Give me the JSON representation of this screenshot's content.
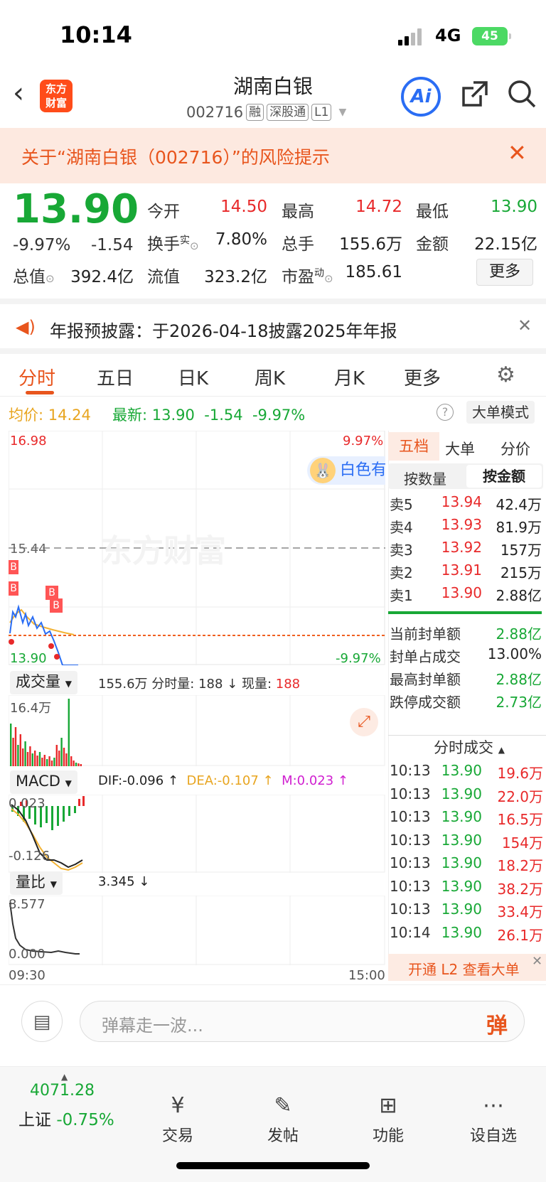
{
  "status_bar": {
    "time": "10:14",
    "network": "4G",
    "battery": "45"
  },
  "header": {
    "logo": "东方财富",
    "title": "湖南白银",
    "code": "002716",
    "tags": [
      "融",
      "深股通",
      "L1"
    ]
  },
  "risk": {
    "text": "关于“湖南白银（002716）”的风险提示"
  },
  "quote": {
    "price": "13.90",
    "change_pct": "-9.97%",
    "change": "-1.54",
    "fields": [
      {
        "label": "今开",
        "value": "14.50"
      },
      {
        "label": "最高",
        "value": "14.72"
      },
      {
        "label": "最低",
        "value": "13.90"
      },
      {
        "label": "换手",
        "value": "7.80%"
      },
      {
        "label": "总手",
        "value": "155.6万"
      },
      {
        "label": "金额",
        "value": "22.15亿"
      },
      {
        "label": "总值",
        "value": "392.4亿"
      },
      {
        "label": "流值",
        "value": "323.2亿"
      },
      {
        "label": "市盈",
        "value": "185.61"
      }
    ],
    "turnover_sup": "实",
    "pe_sup": "动",
    "more": "更多"
  },
  "announcement": {
    "text": "年报预披露：于2026-04-18披露2025年年报"
  },
  "tabs": [
    "分时",
    "五日",
    "日K",
    "周K",
    "月K",
    "更多"
  ],
  "summary": {
    "avg_label": "均价:",
    "avg": "14.24",
    "latest_label": "最新:",
    "latest": "13.90",
    "chg": "-1.54",
    "pct": "-9.97%",
    "mode": "大单模式"
  },
  "chart": {
    "top_price": "16.98",
    "top_pct": "9.97%",
    "mid_price": "15.44",
    "bottom_price": "13.90",
    "bottom_pct": "-9.97%",
    "watermark": "东方财富",
    "start": "09:30",
    "end": "15:00",
    "ad": "白色有"
  },
  "volume": {
    "selector": "成交量",
    "total": "155.6万",
    "tick_label": "分时量:",
    "tick": "188",
    "now_label": "现量:",
    "now": "188",
    "max": "16.4万"
  },
  "macd": {
    "selector": "MACD",
    "dif": "DIF:-0.096 ↑",
    "dea": "DEA:-0.107 ↑",
    "m": "M:0.023 ↑",
    "top": "0.023",
    "bottom": "-0.126"
  },
  "ratio": {
    "selector": "量比",
    "value": "3.345 ↓",
    "top": "8.577",
    "bottom": "0.000"
  },
  "orderbook": {
    "tabs": [
      "五档",
      "大单",
      "分价"
    ],
    "sub": [
      "按数量",
      "按金额"
    ],
    "asks": [
      {
        "l": "卖5",
        "p": "13.94",
        "v": "42.4万"
      },
      {
        "l": "卖4",
        "p": "13.93",
        "v": "81.9万"
      },
      {
        "l": "卖3",
        "p": "13.92",
        "v": "157万"
      },
      {
        "l": "卖2",
        "p": "13.91",
        "v": "215万"
      },
      {
        "l": "卖1",
        "p": "13.90",
        "v": "2.88亿"
      }
    ],
    "stats": [
      {
        "l": "当前封单额",
        "v": "2.88亿"
      },
      {
        "l": "封单占成交",
        "v": "13.00%"
      },
      {
        "l": "最高封单额",
        "v": "2.88亿"
      },
      {
        "l": "跌停成交额",
        "v": "2.73亿"
      }
    ]
  },
  "trades": {
    "title": "分时成交",
    "rows": [
      {
        "t": "10:13",
        "p": "13.90",
        "v": "19.6万"
      },
      {
        "t": "10:13",
        "p": "13.90",
        "v": "22.0万"
      },
      {
        "t": "10:13",
        "p": "13.90",
        "v": "16.5万"
      },
      {
        "t": "10:13",
        "p": "13.90",
        "v": "154万"
      },
      {
        "t": "10:13",
        "p": "13.90",
        "v": "18.2万"
      },
      {
        "t": "10:13",
        "p": "13.90",
        "v": "38.2万"
      },
      {
        "t": "10:13",
        "p": "13.90",
        "v": "33.4万"
      },
      {
        "t": "10:14",
        "p": "13.90",
        "v": "26.1万"
      }
    ],
    "l2": "开通 L2 查看大单"
  },
  "chat": {
    "placeholder": "弹幕走一波...",
    "danmu": "弹"
  },
  "bottom": {
    "index_value": "4071.28",
    "index_name": "上证",
    "index_pct": "-0.75%",
    "items": [
      "交易",
      "发帖",
      "功能",
      "设自选"
    ]
  }
}
